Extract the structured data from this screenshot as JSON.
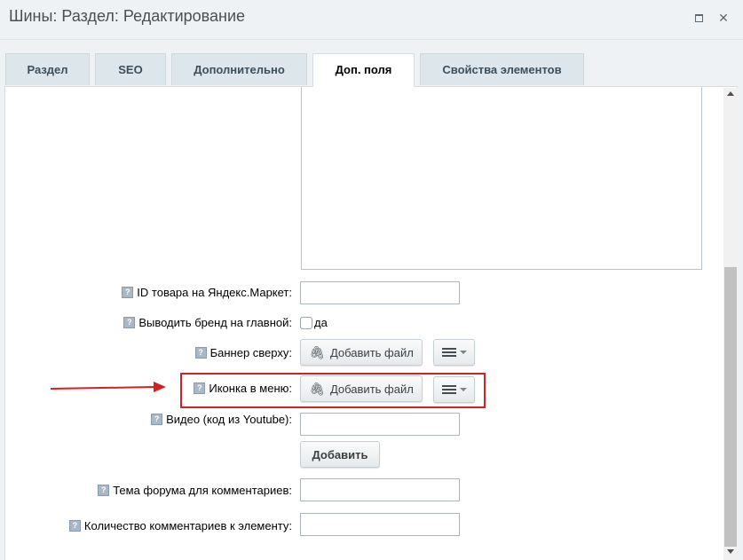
{
  "window": {
    "title": "Шины: Раздел: Редактирование"
  },
  "tabs": [
    {
      "label": "Раздел"
    },
    {
      "label": "SEO"
    },
    {
      "label": "Дополнительно"
    },
    {
      "label": "Доп. поля",
      "active": true
    },
    {
      "label": "Свойства элементов"
    }
  ],
  "fields": {
    "yandex_id": {
      "label": "ID товара на Яндекс.Маркет:",
      "value": ""
    },
    "show_brand": {
      "label": "Выводить бренд на главной:",
      "checkbox_label": "да",
      "checked": false
    },
    "banner_top": {
      "label": "Баннер сверху:",
      "button_label": "Добавить файл"
    },
    "menu_icon": {
      "label": "Иконка в меню:",
      "button_label": "Добавить файл"
    },
    "video": {
      "label": "Видео (код из Youtube):",
      "value": "",
      "add_button_label": "Добавить"
    },
    "forum_topic": {
      "label": "Тема форума для комментариев:",
      "value": ""
    },
    "comment_count": {
      "label": "Количество комментариев к элементу:",
      "value": ""
    }
  },
  "icons": {
    "help": "?",
    "close": "✕",
    "clip": "📎"
  },
  "colors": {
    "highlight": "#d32222",
    "active_tab": "#ffffff",
    "inactive_tab": "#dde6ea"
  }
}
